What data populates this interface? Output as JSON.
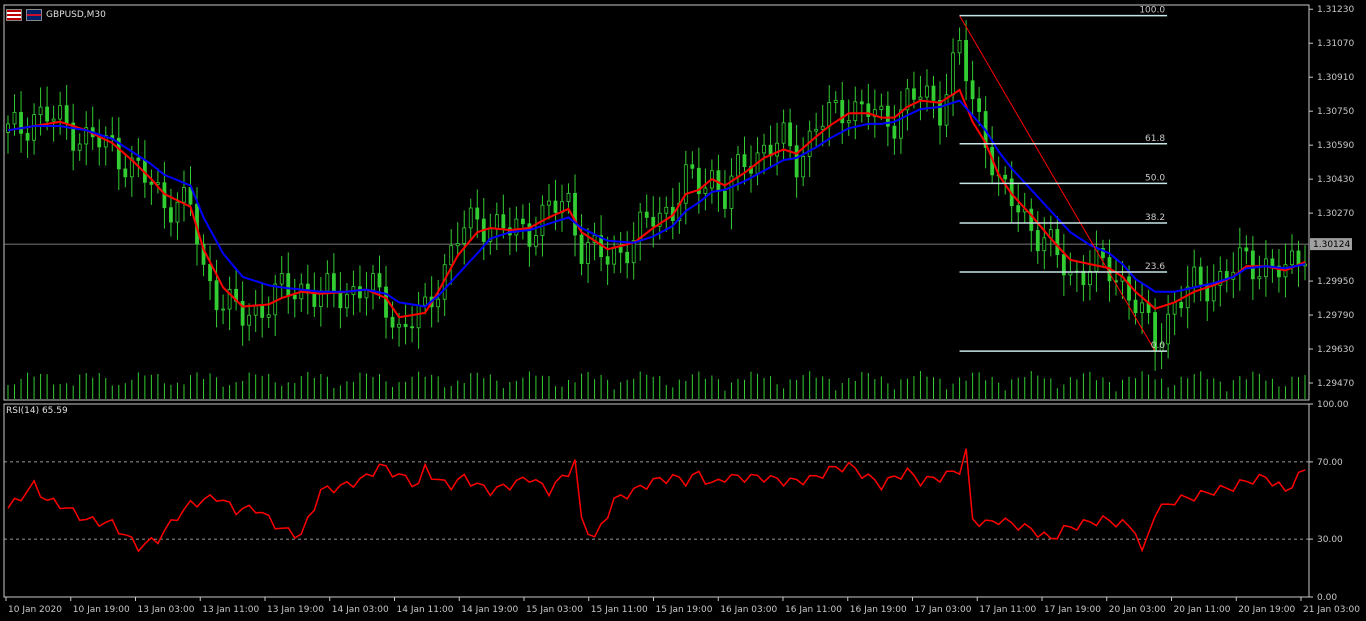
{
  "header": {
    "symbol": "GBPUSD,M30",
    "flag_left_icon": "usa-flag-icon",
    "flag_right_icon": "uk-flag-icon"
  },
  "rsi_panel": {
    "title": "RSI(14) 65.59"
  },
  "colors": {
    "background": "#000000",
    "bull_candle": "#32cd32",
    "ma_fast": "#ff0000",
    "ma_slow": "#0000ff",
    "rsi_line": "#ff0000",
    "fib": "#c8e6e6",
    "volume": "#32cd32",
    "current_price_line": "#a0a0a0"
  },
  "chart_data": [
    {
      "type": "candlestick",
      "title": "GBPUSD,M30",
      "ylim": [
        1.2939,
        1.3125
      ],
      "yticks": [
        "1.31230",
        "1.31070",
        "1.30910",
        "1.30750",
        "1.30590",
        "1.30430",
        "1.30270",
        "1.30124",
        "1.29950",
        "1.29790",
        "1.29630",
        "1.29470"
      ],
      "current_price": "1.30124",
      "xticks": [
        "10 Jan 2020",
        "10 Jan 19:00",
        "13 Jan 03:00",
        "13 Jan 11:00",
        "13 Jan 19:00",
        "14 Jan 03:00",
        "14 Jan 11:00",
        "14 Jan 19:00",
        "15 Jan 03:00",
        "15 Jan 11:00",
        "15 Jan 19:00",
        "16 Jan 03:00",
        "16 Jan 11:00",
        "16 Jan 19:00",
        "17 Jan 03:00",
        "17 Jan 11:00",
        "17 Jan 19:00",
        "20 Jan 03:00",
        "20 Jan 11:00",
        "20 Jan 19:00",
        "21 Jan 03:00"
      ],
      "close_path": {
        "x_index": [
          0,
          2,
          4,
          8,
          12,
          16,
          19,
          22,
          24,
          28,
          30,
          33,
          36,
          40,
          42,
          45,
          48,
          52,
          55,
          58,
          60,
          64,
          66,
          69,
          72,
          74,
          77,
          80,
          83,
          86,
          88,
          92,
          96,
          99,
          102,
          104,
          106,
          108,
          110,
          113,
          116,
          119,
          121,
          124,
          126,
          129,
          132,
          134,
          136,
          138,
          140,
          143,
          146,
          148,
          150,
          152,
          154,
          157,
          160,
          163,
          166,
          169,
          171,
          173,
          176,
          179,
          182,
          185,
          188,
          190,
          193,
          196,
          199
        ],
        "close": [
          1.3065,
          1.3067,
          1.3074,
          1.307,
          1.3062,
          1.3058,
          1.3049,
          1.304,
          1.3033,
          1.303,
          1.3,
          1.2985,
          1.2978,
          1.2985,
          1.299,
          1.2992,
          1.2988,
          1.299,
          1.2992,
          1.2985,
          1.2972,
          1.298,
          1.2995,
          1.3015,
          1.3025,
          1.3022,
          1.3018,
          1.302,
          1.3028,
          1.3032,
          1.3012,
          1.3005,
          1.3015,
          1.3025,
          1.303,
          1.3042,
          1.304,
          1.3045,
          1.3035,
          1.305,
          1.3058,
          1.306,
          1.3052,
          1.3068,
          1.3072,
          1.3078,
          1.3075,
          1.307,
          1.3072,
          1.308,
          1.3082,
          1.3078,
          1.3105,
          1.3078,
          1.3065,
          1.304,
          1.3032,
          1.3022,
          1.301,
          1.2998,
          1.3002,
          1.3,
          1.2995,
          1.2985,
          1.2965,
          1.2985,
          1.2992,
          1.2995,
          1.3,
          1.3005,
          1.3002,
          1.2998,
          1.3012
        ]
      },
      "moving_averages": [
        {
          "color": "#ff0000",
          "values": [
            1.3066,
            1.3067,
            1.3068,
            1.307,
            1.3066,
            1.306,
            1.3052,
            1.3043,
            1.3036,
            1.303,
            1.301,
            1.2992,
            1.2983,
            1.2984,
            1.2987,
            1.299,
            1.2989,
            1.299,
            1.2991,
            1.2987,
            1.2978,
            1.298,
            1.299,
            1.3007,
            1.3018,
            1.302,
            1.3019,
            1.302,
            1.3025,
            1.3029,
            1.3018,
            1.301,
            1.3013,
            1.302,
            1.3026,
            1.3036,
            1.3038,
            1.3043,
            1.304,
            1.3046,
            1.3053,
            1.3057,
            1.3055,
            1.3063,
            1.3068,
            1.3074,
            1.3074,
            1.3072,
            1.3072,
            1.3077,
            1.308,
            1.3079,
            1.3085,
            1.307,
            1.306,
            1.3045,
            1.3036,
            1.3026,
            1.3015,
            1.3005,
            1.3003,
            1.3001,
            1.2997,
            1.299,
            1.2982,
            1.2985,
            1.299,
            1.2993,
            1.2997,
            1.3002,
            1.3002,
            1.3,
            1.3004
          ]
        },
        {
          "color": "#0000ff",
          "values": [
            1.3066,
            1.3067,
            1.3068,
            1.3068,
            1.3066,
            1.3062,
            1.3056,
            1.305,
            1.3045,
            1.304,
            1.3025,
            1.3008,
            1.2997,
            1.2993,
            1.2992,
            1.2991,
            1.299,
            1.299,
            1.2991,
            1.2989,
            1.2985,
            1.2983,
            1.2988,
            1.2998,
            1.3008,
            1.3015,
            1.3018,
            1.3019,
            1.3022,
            1.3025,
            1.302,
            1.3014,
            1.3013,
            1.3016,
            1.3021,
            1.3028,
            1.3032,
            1.3037,
            1.3038,
            1.3042,
            1.3047,
            1.3052,
            1.3053,
            1.3058,
            1.3062,
            1.3067,
            1.3069,
            1.3069,
            1.307,
            1.3073,
            1.3076,
            1.3077,
            1.308,
            1.3073,
            1.3066,
            1.3056,
            1.3048,
            1.3038,
            1.3028,
            1.3018,
            1.3012,
            1.3008,
            1.3003,
            1.2996,
            1.299,
            1.299,
            1.2992,
            1.2994,
            1.2997,
            1.3001,
            1.3002,
            1.3001,
            1.3003
          ]
        }
      ],
      "fibonacci": {
        "high": 1.312,
        "low": 1.2962,
        "levels": [
          {
            "ratio": 1.0,
            "label": "100.0"
          },
          {
            "ratio": 0.618,
            "label": "61.8"
          },
          {
            "ratio": 0.5,
            "label": "50.0"
          },
          {
            "ratio": 0.382,
            "label": "38.2"
          },
          {
            "ratio": 0.236,
            "label": "23.6"
          },
          {
            "ratio": 0.0,
            "label": "0.0"
          }
        ]
      }
    },
    {
      "type": "line",
      "title": "RSI(14) 65.59",
      "ylim": [
        0,
        100
      ],
      "yticks": [
        "100.00",
        "70.00",
        "30.00",
        "0.00"
      ],
      "levels": [
        70,
        30
      ],
      "series": [
        {
          "name": "RSI(14)",
          "x_index": [
            0,
            2,
            4,
            6,
            8,
            12,
            16,
            18,
            20,
            23,
            26,
            28,
            30,
            32,
            35,
            38,
            42,
            45,
            48,
            52,
            55,
            57,
            60,
            63,
            64,
            66,
            68,
            70,
            72,
            74,
            77,
            80,
            83,
            86,
            87,
            88,
            90,
            93,
            96,
            99,
            102,
            104,
            106,
            108,
            110,
            113,
            116,
            119,
            121,
            124,
            126,
            129,
            132,
            134,
            136,
            138,
            140,
            143,
            146,
            147,
            148,
            150,
            152,
            154,
            157,
            160,
            162,
            165,
            168,
            171,
            173,
            174,
            176,
            179,
            182,
            185,
            188,
            190,
            193,
            196,
            199
          ],
          "values": [
            46,
            52,
            58,
            50,
            48,
            40,
            38,
            32,
            26,
            30,
            42,
            48,
            50,
            52,
            45,
            46,
            35,
            32,
            55,
            58,
            62,
            68,
            63,
            58,
            67,
            60,
            58,
            62,
            58,
            55,
            58,
            62,
            55,
            65,
            70,
            40,
            30,
            50,
            55,
            60,
            62,
            60,
            64,
            58,
            62,
            62,
            62,
            60,
            60,
            62,
            66,
            68,
            62,
            58,
            62,
            65,
            60,
            62,
            66,
            75,
            40,
            38,
            40,
            38,
            35,
            30,
            35,
            38,
            40,
            38,
            35,
            22,
            44,
            50,
            52,
            55,
            57,
            60,
            62,
            55,
            66
          ]
        }
      ]
    }
  ]
}
